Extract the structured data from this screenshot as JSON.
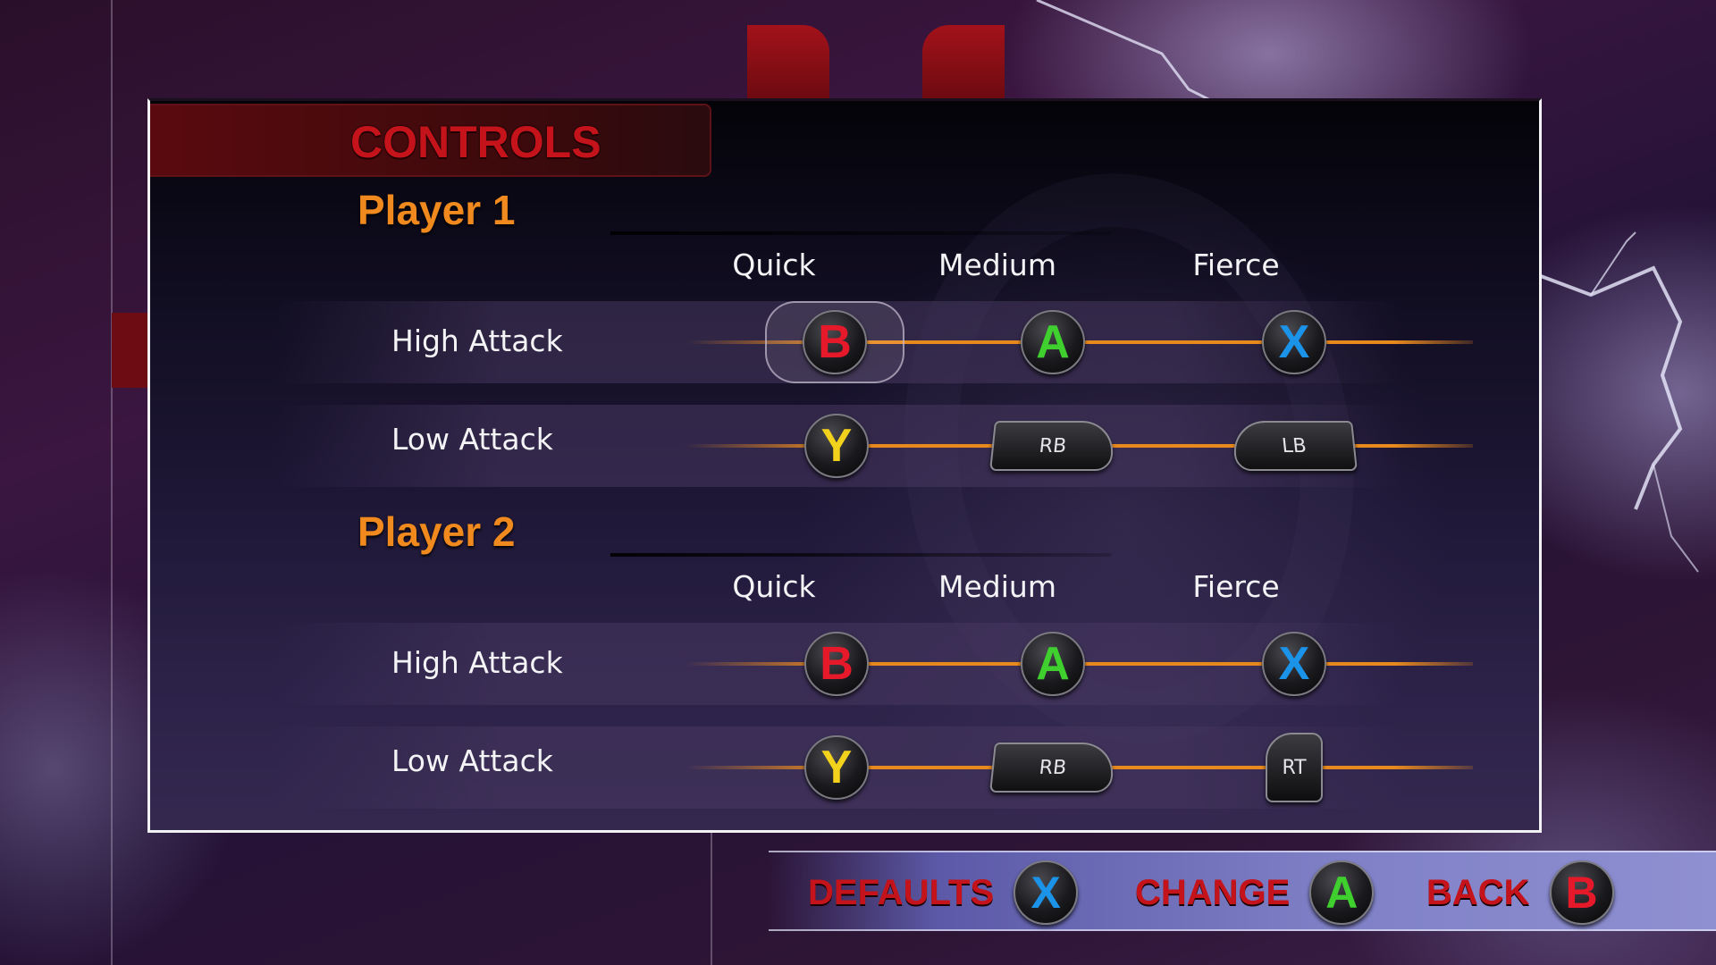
{
  "screen": {
    "title": "CONTROLS",
    "columns": [
      "Quick",
      "Medium",
      "Fierce"
    ]
  },
  "players": [
    {
      "name": "Player 1",
      "rows": [
        {
          "label": "High Attack",
          "bindings": [
            "B",
            "A",
            "X"
          ],
          "selected_index": 0
        },
        {
          "label": "Low Attack",
          "bindings": [
            "Y",
            "RB",
            "LB"
          ]
        }
      ]
    },
    {
      "name": "Player 2",
      "rows": [
        {
          "label": "High Attack",
          "bindings": [
            "B",
            "A",
            "X"
          ]
        },
        {
          "label": "Low Attack",
          "bindings": [
            "Y",
            "RB",
            "RT"
          ]
        }
      ]
    }
  ],
  "actions": [
    {
      "label": "DEFAULTS",
      "button": "X"
    },
    {
      "label": "CHANGE",
      "button": "A"
    },
    {
      "label": "BACK",
      "button": "B"
    }
  ],
  "colors": {
    "accent_orange": "#f08a1e",
    "title_red": "#c4131a",
    "button_A": "#3fcf2e",
    "button_B": "#e5192a",
    "button_X": "#1a93e8",
    "button_Y": "#f3d21c"
  }
}
